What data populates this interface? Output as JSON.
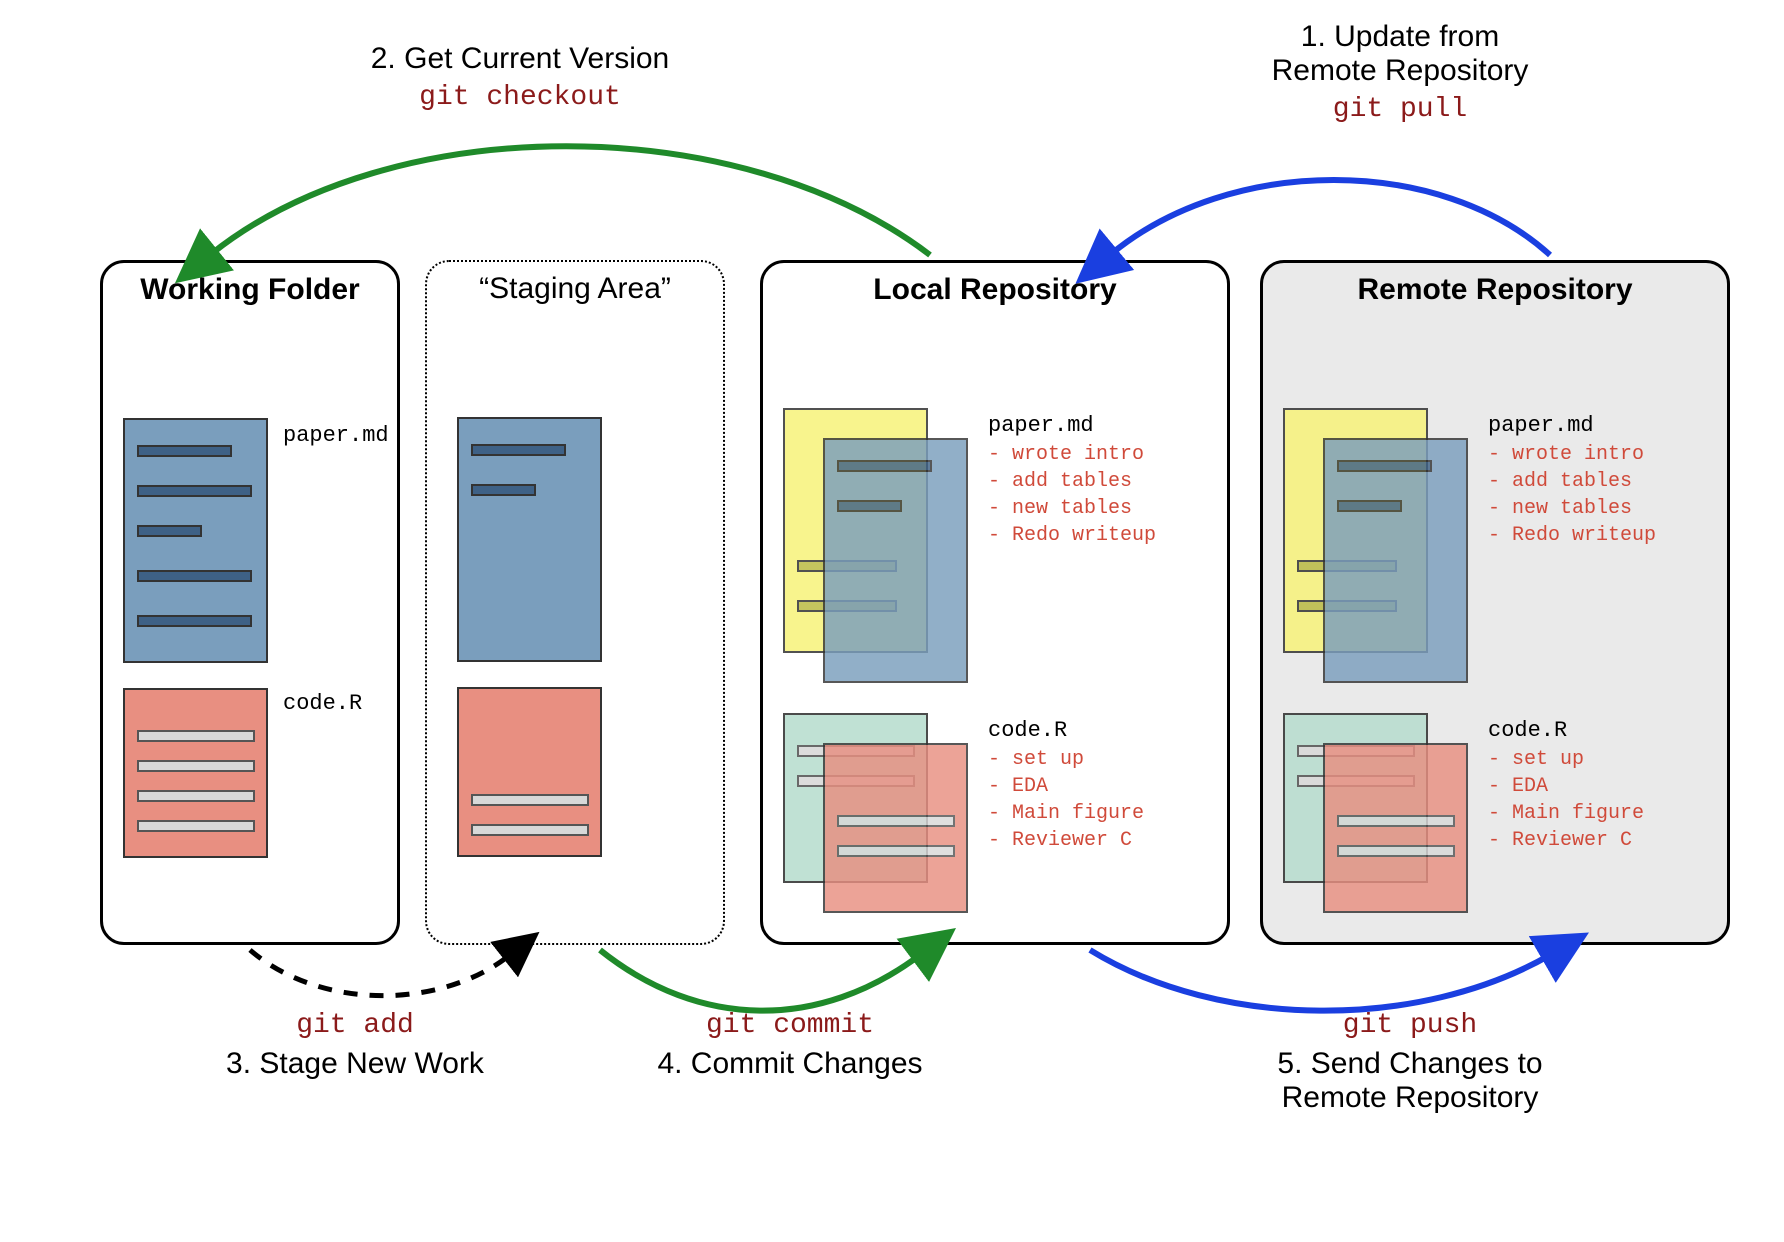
{
  "steps": {
    "s1": {
      "title": "1. Update from\nRemote Repository",
      "cmd": "git pull"
    },
    "s2": {
      "title": "2. Get Current Version",
      "cmd": "git checkout"
    },
    "s3": {
      "title": "3. Stage New Work",
      "cmd": "git add"
    },
    "s4": {
      "title": "4. Commit Changes",
      "cmd": "git commit"
    },
    "s5": {
      "title": "5. Send Changes to\nRemote Repository",
      "cmd": "git push"
    }
  },
  "panels": {
    "working": {
      "title": "Working Folder"
    },
    "staging": {
      "title": "“Staging Area”"
    },
    "local": {
      "title": "Local Repository"
    },
    "remote": {
      "title": "Remote Repository"
    }
  },
  "files": {
    "paper": {
      "name": "paper.md",
      "changes": "- wrote intro\n- add tables\n- new tables\n- Redo writeup"
    },
    "code": {
      "name": "code.R",
      "changes": "- set up\n- EDA\n- Main figure\n- Reviewer C"
    }
  },
  "colors": {
    "arrow_green": "#1f8a2a",
    "arrow_blue": "#1a3fe0",
    "arrow_black": "#000000"
  }
}
